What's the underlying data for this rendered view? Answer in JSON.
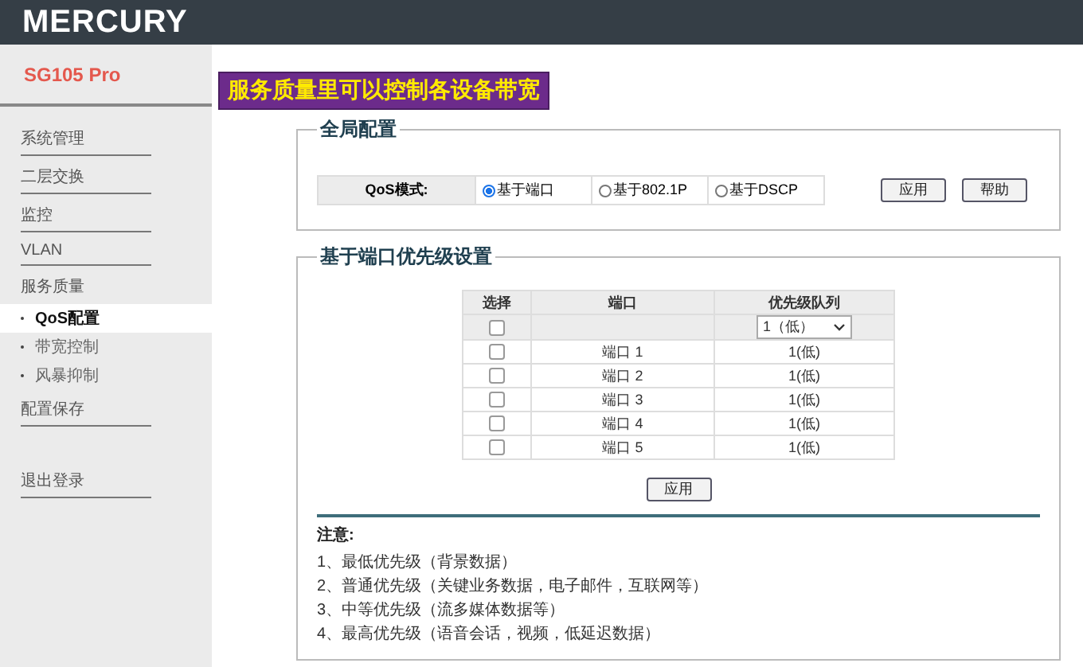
{
  "header": {
    "logo": "MERCURY"
  },
  "sidebar": {
    "model": "SG105 Pro",
    "items": [
      {
        "label": "系统管理",
        "selected": false,
        "expanded": false
      },
      {
        "label": "二层交换",
        "selected": false,
        "expanded": false
      },
      {
        "label": "监控",
        "selected": false,
        "expanded": false
      },
      {
        "label": "VLAN",
        "selected": false,
        "expanded": false
      },
      {
        "label": "服务质量",
        "selected": false,
        "expanded": true,
        "children": [
          {
            "label": "QoS配置",
            "selected": true
          },
          {
            "label": "带宽控制",
            "selected": false
          },
          {
            "label": "风暴抑制",
            "selected": false
          }
        ]
      },
      {
        "label": "配置保存",
        "selected": false,
        "expanded": false
      }
    ],
    "logout": "退出登录"
  },
  "caption": "服务质量里可以控制各设备带宽",
  "global_config": {
    "title": "全局配置",
    "mode_label": "QoS模式:",
    "options": [
      {
        "label": "基于端口",
        "selected": true
      },
      {
        "label": "基于802.1P",
        "selected": false
      },
      {
        "label": "基于DSCP",
        "selected": false
      }
    ],
    "buttons": [
      "应用",
      "帮助"
    ]
  },
  "port_priority": {
    "title": "基于端口优先级设置",
    "columns": [
      "选择",
      "端口",
      "优先级队列"
    ],
    "bulk": {
      "checked": false,
      "queue": "1（低）"
    },
    "rows": [
      {
        "checked": false,
        "port": "端口 1",
        "queue": "1(低)"
      },
      {
        "checked": false,
        "port": "端口 2",
        "queue": "1(低)"
      },
      {
        "checked": false,
        "port": "端口 3",
        "queue": "1(低)"
      },
      {
        "checked": false,
        "port": "端口 4",
        "queue": "1(低)"
      },
      {
        "checked": false,
        "port": "端口 5",
        "queue": "1(低)"
      }
    ],
    "apply": "应用",
    "note_title": "注意:",
    "notes": [
      "1、最低优先级（背景数据）",
      "2、普通优先级（关键业务数据，电子邮件，互联网等）",
      "3、中等优先级（流多媒体数据等）",
      "4、最高优先级（语音会话，视频，低延迟数据）"
    ]
  }
}
